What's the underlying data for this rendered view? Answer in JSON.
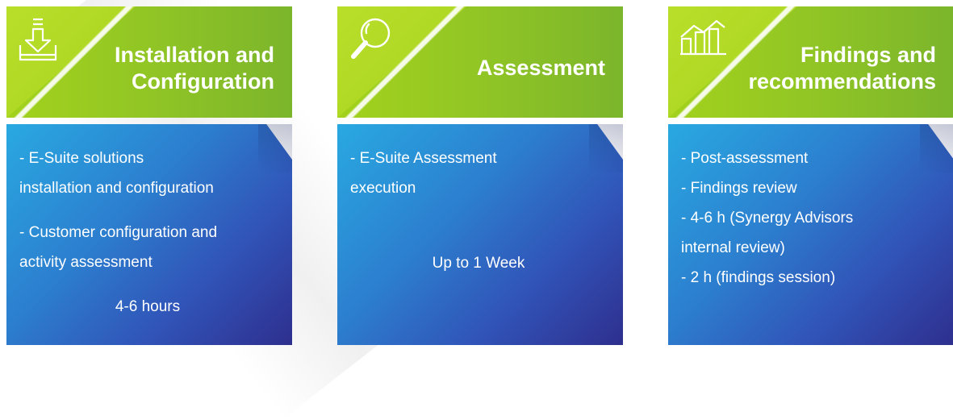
{
  "cards": [
    {
      "icon": "download-tray-icon",
      "title_line1": "Installation and",
      "title_line2": "Configuration",
      "lines": [
        "- E-Suite solutions",
        "installation and configuration",
        "- Customer configuration and",
        "activity assessment"
      ],
      "duration": "4-6 hours"
    },
    {
      "icon": "magnifier-icon",
      "title_line1": "Assessment",
      "lines": [
        "- E-Suite Assessment",
        "execution"
      ],
      "duration": "Up to 1 Week"
    },
    {
      "icon": "bar-chart-trend-icon",
      "title_line1": "Findings and",
      "title_line2": "recommendations",
      "lines": [
        "- Post-assessment",
        "- Findings review",
        "- 4-6 h (Synergy Advisors",
        "internal review)",
        "- 2 h (findings session)"
      ]
    }
  ],
  "colors": {
    "header_green": "#8fc426",
    "body_blue_start": "#29a9e1",
    "body_blue_end": "#2e2f8e"
  }
}
